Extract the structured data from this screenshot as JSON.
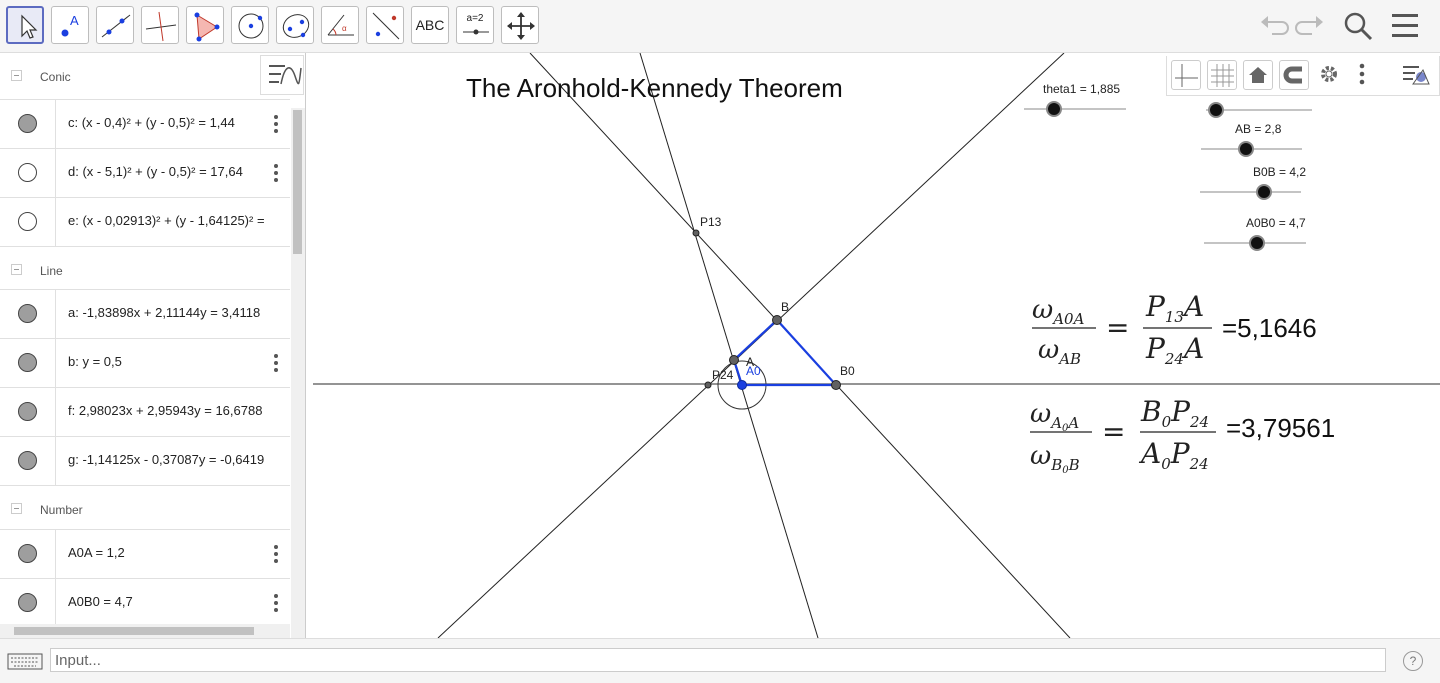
{
  "toolbar": {
    "text_tool_label": "ABC",
    "slider_tool_label": "a=2"
  },
  "algebra": {
    "sections": [
      {
        "title": "Conic",
        "items": [
          {
            "label": "c: (x - 0,4)² + (y - 0,5)² = 1,44",
            "filled": true
          },
          {
            "label": "d: (x - 5,1)² + (y - 0,5)² = 17,64",
            "filled": false
          },
          {
            "label": "e: (x - 0,02913)² + (y - 1,64125)² = ",
            "filled": false
          }
        ]
      },
      {
        "title": "Line",
        "items": [
          {
            "label": "a: -1,83898x + 2,11144y = 3,4118",
            "filled": true
          },
          {
            "label": "b: y = 0,5",
            "filled": true
          },
          {
            "label": "f: 2,98023x + 2,95943y = 16,6788",
            "filled": true
          },
          {
            "label": "g: -1,14125x - 0,37087y = -0,6419",
            "filled": true
          }
        ]
      },
      {
        "title": "Number",
        "items": [
          {
            "label": "A0A = 1,2",
            "filled": true
          },
          {
            "label": "A0B0 = 4,7",
            "filled": true
          }
        ]
      }
    ]
  },
  "graphics": {
    "title": "The Aronhold-Kennedy Theorem",
    "sliders": [
      {
        "label": "theta1 = 1,885",
        "value": 1.885,
        "min": 0,
        "max": 6.283
      },
      {
        "label": "",
        "value": 0.15,
        "min": 0,
        "max": 1
      },
      {
        "label": "AB = 2,8",
        "value": 2.8,
        "min": 0,
        "max": 6
      },
      {
        "label": "B0B = 4,2",
        "value": 4.2,
        "min": 0,
        "max": 6
      },
      {
        "label": "A0B0 = 4,7",
        "value": 4.7,
        "min": 0,
        "max": 9
      }
    ],
    "points": {
      "A": "A",
      "A0": "A0",
      "B": "B",
      "B0": "B0",
      "P13": "P13",
      "P24": "P24"
    },
    "formula1": {
      "lhs_num": "ω",
      "lhs_num_sub": "A0A",
      "lhs_den": "ω",
      "lhs_den_sub": "AB",
      "rhs_num": "P",
      "rhs_num_sub": "13",
      "rhs_num_tail": "A",
      "rhs_den": "P",
      "rhs_den_sub": "24",
      "rhs_den_tail": "A",
      "value": "=5,1646"
    },
    "formula2": {
      "lhs_num": "ω",
      "lhs_num_sub": "A",
      "lhs_num_sub2": "0",
      "lhs_num_sub3": "A",
      "lhs_den": "ω",
      "lhs_den_sub": "B",
      "lhs_den_sub2": "0",
      "lhs_den_sub3": "B",
      "rhs_num": "B",
      "rhs_num_sub": "0",
      "rhs_num_mid": "P",
      "rhs_num_sub2": "24",
      "rhs_den": "A",
      "rhs_den_sub": "0",
      "rhs_den_mid": "P",
      "rhs_den_sub2": "24",
      "value": "=3,79561"
    }
  },
  "input": {
    "placeholder": "Input..."
  },
  "help": "?",
  "colors": {
    "accent": "#5c6bc0",
    "triangle": "#1a3fe0",
    "point_dark": "#616161"
  }
}
